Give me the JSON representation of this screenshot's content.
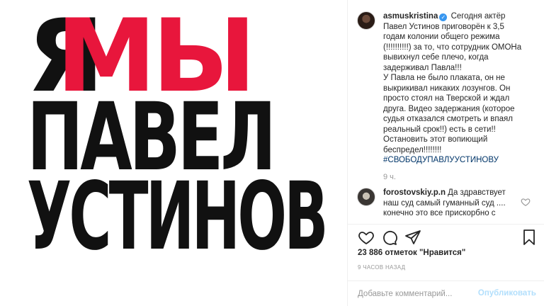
{
  "poster": {
    "ya": "Я",
    "my": "МЫ",
    "first_name": "ПАВЕЛ",
    "last_name": "УСТИНОВ",
    "accent_color": "#e8163c"
  },
  "post": {
    "author": "asmuskristina",
    "verified_icon": "verified-badge-icon",
    "caption_lines": [
      "Сегодня актёр",
      "Павел Устинов приговорён к 3,5",
      "годам колонии общего режима",
      "(!!!!!!!!!!) за то, что сотрудник ОМОНа",
      "вывихнул себе плечо, когда",
      "задерживал Павла!!!",
      "У Павла не было плаката, он не",
      "выкрикивал никаких лозунгов. Он",
      "просто стоял на Тверской и ждал",
      "друга. Видео задержания (которое",
      "судья отказался смотреть и впаял",
      "реальный срок!!) есть в сети!!",
      "Остановить этот вопиющий",
      "беспредел!!!!!!!!"
    ],
    "hashtag": "#СВОБОДУПАВЛУУСТИНОВУ",
    "caption_time": "9 ч."
  },
  "reply": {
    "author": "forostovskiy.p.n",
    "lines": [
      "Да здравствует",
      "наш суд самый гуманный суд ....",
      "конечно это все прискорбно с"
    ]
  },
  "actions": {
    "like_icon": "heart-icon",
    "comment_icon": "comment-icon",
    "share_icon": "share-icon",
    "save_icon": "bookmark-icon",
    "likes_text": "23 886 отметок \"Нравится\"",
    "time_ago": "9 ЧАСОВ НАЗАД"
  },
  "add_comment": {
    "placeholder": "Добавьте комментарий...",
    "publish_label": "Опубликовать"
  }
}
